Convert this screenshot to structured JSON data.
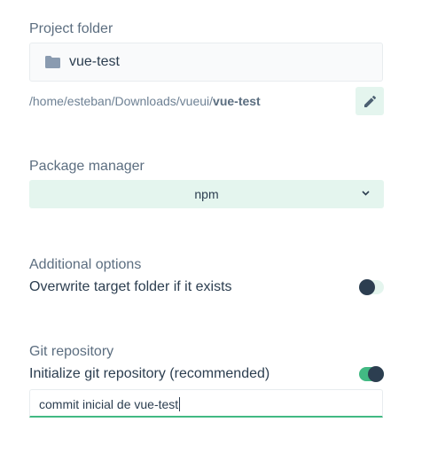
{
  "project_folder": {
    "label": "Project folder",
    "folder_name": "vue-test",
    "path_prefix": "/home/esteban/Downloads/vueui/",
    "path_name": "vue-test"
  },
  "package_manager": {
    "label": "Package manager",
    "selected": "npm"
  },
  "additional_options": {
    "label": "Additional options",
    "overwrite_label": "Overwrite target folder if it exists",
    "overwrite_enabled": false
  },
  "git": {
    "label": "Git repository",
    "init_label": "Initialize git repository (recommended)",
    "init_enabled": true,
    "commit_message": "commit inicial de vue-test"
  },
  "colors": {
    "accent": "#42b983",
    "accent_light": "#e4f5ee",
    "text": "#2c3e50",
    "muted": "#6e8194"
  },
  "icons": {
    "folder": "folder-icon",
    "edit": "pencil-icon",
    "dropdown": "chevron-down-icon"
  }
}
